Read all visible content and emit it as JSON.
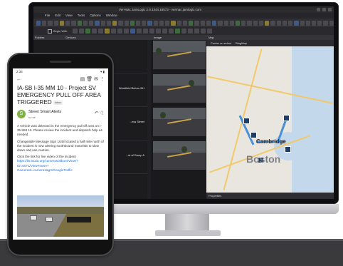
{
  "monitor": {
    "title": "Ver-Mac JamLogic 2.9.1344.16573 - vermac.jamlogic.com",
    "menu": [
      "File",
      "Edit",
      "View",
      "Tools",
      "Options",
      "Window"
    ],
    "begin_label": "Begin With",
    "panels": {
      "left_tab": "Folders",
      "left_tab2": "Devices",
      "video_tab": "Image",
      "map_tab": "Map",
      "map_center": "Center on select",
      "map_type": "BingMap",
      "properties": "Properties"
    },
    "camera_rows": [
      {
        "label": ""
      },
      {
        "label": "Westfield Before BH"
      },
      {
        "label": "...ess Street"
      },
      {
        "label": "...st of Ramp A"
      }
    ],
    "map_city": "Boston",
    "map_city2": "Cambridge"
  },
  "phone": {
    "time": "2:34",
    "status_icons": "▾ ▮",
    "subject": "IA-SB I-35 MM 10 - Project SV EMERGENCY PULL OFF AREA TRIGGERED",
    "inbox_chip": "Inbox",
    "sender": "Street Smart Alerts",
    "to": "to me",
    "avatar_letter": "S",
    "para1": "A vehicle was detected in the emergency pull off area on I-35 MM 10. Please review the incident and dispatch help as needed.",
    "para2": "Changeable Message Sign 1048 located a half mile north of the incident is now alerting southbound motorists to slow down and use caution.",
    "para3_prefix": "Click the link for live video of the incident",
    "para3_link": "https://lis.511ia.org/cameras/album/View/?ID=6071/ViewFrame?CameraId=camera1&gIr/GoogleTraffic"
  },
  "colors": {
    "avatar": "#7cb342",
    "link": "#1a73e8",
    "map_route": "#4b8fd6"
  }
}
